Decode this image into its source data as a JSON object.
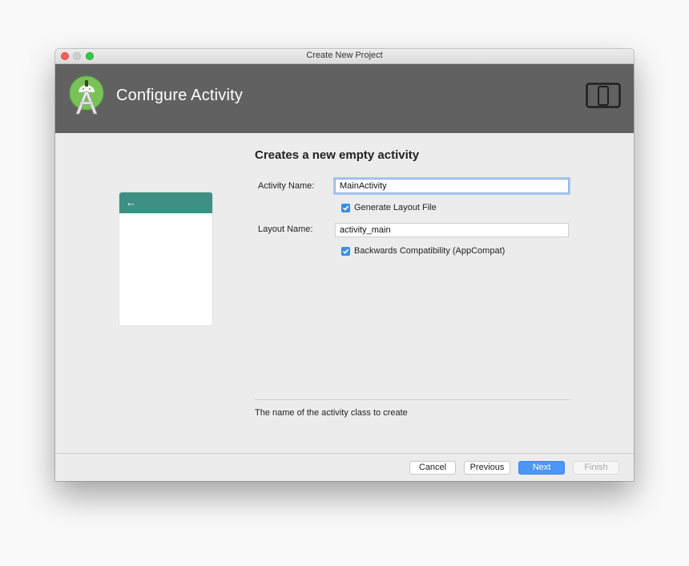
{
  "window": {
    "title": "Create New Project"
  },
  "banner": {
    "title": "Configure Activity",
    "logo_icon": "android-studio-icon",
    "device_icon": "tablet-phone-icon",
    "background": "#616161"
  },
  "preview": {
    "appbar_color": "#3d9083",
    "back_icon": "←"
  },
  "form": {
    "heading": "Creates a new empty activity",
    "activity_name_label": "Activity Name:",
    "activity_name_value": "MainActivity",
    "generate_layout_label": "Generate Layout File",
    "generate_layout_checked": true,
    "layout_name_label": "Layout Name:",
    "layout_name_value": "activity_main",
    "backwards_compat_label": "Backwards Compatibility (AppCompat)",
    "backwards_compat_checked": true,
    "help_text": "The name of the activity class to create"
  },
  "buttons": {
    "cancel": "Cancel",
    "previous": "Previous",
    "next": "Next",
    "finish": "Finish"
  },
  "colors": {
    "accent": "#4e96f5",
    "checkbox": "#3a8ee6"
  }
}
